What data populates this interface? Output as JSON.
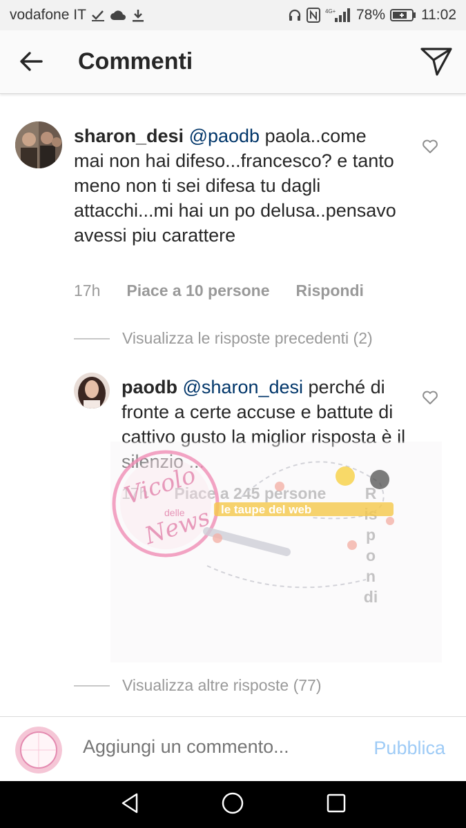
{
  "status_bar": {
    "carrier": "vodafone IT",
    "network": "4G+",
    "battery": "78%",
    "time": "11:02"
  },
  "header": {
    "title": "Commenti"
  },
  "comments": [
    {
      "username": "sharon_desi",
      "mention": "@paodb",
      "text": " paola..come mai non hai difeso...francesco? e tanto meno non ti sei difesa tu dagli attacchi...mi hai un po delusa..pensavo avessi piu carattere",
      "time": "17h",
      "likes": "Piace a 10 persone",
      "reply": "Rispondi"
    },
    {
      "username": "paodb",
      "mention": "@sharon_desi",
      "text": " perché di fronte a certe accuse e battute di cattivo gusto la miglior risposta è il silenzio ...",
      "time": "17h",
      "likes": "Piace a 245 persone",
      "reply": "Rispondi"
    }
  ],
  "view_previous": "Visualizza le risposte precedenti (2)",
  "view_more": "Visualizza altre risposte (77)",
  "watermark": {
    "text_main": "Vicolo",
    "text_delle": "delle",
    "text_news": "News",
    "text_banner": "le taupe del web"
  },
  "composer": {
    "placeholder": "Aggiungi un commento...",
    "publish": "Pubblica"
  },
  "colors": {
    "mention": "#003569",
    "publish": "#9ecbf6",
    "muted": "#999999"
  }
}
